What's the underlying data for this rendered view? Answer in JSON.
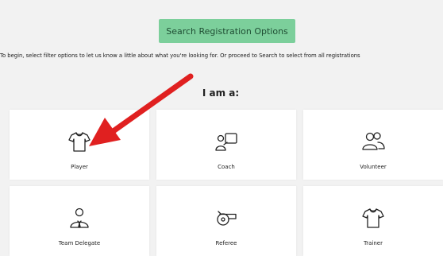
{
  "search_button": {
    "label": "Search Registration Options"
  },
  "intro": {
    "text": "To begin, select filter options to let us know a little about what you're looking for. Or proceed to Search to select from all registrations"
  },
  "heading": {
    "text": "I am a:"
  },
  "roles": [
    {
      "label": "Player",
      "icon": "shirt-icon"
    },
    {
      "label": "Coach",
      "icon": "coach-icon"
    },
    {
      "label": "Volunteer",
      "icon": "people-icon"
    },
    {
      "label": "Team Delegate",
      "icon": "delegate-icon"
    },
    {
      "label": "Referee",
      "icon": "whistle-icon"
    },
    {
      "label": "Trainer",
      "icon": "shirt-icon"
    }
  ],
  "colors": {
    "search_button_bg": "#7ccf9b",
    "arrow": "#e02020",
    "background": "#f2f2f2",
    "card": "#ffffff"
  }
}
